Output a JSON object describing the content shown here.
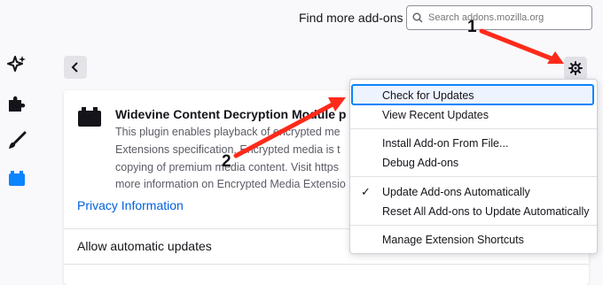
{
  "header": {
    "find_more_label": "Find more add-ons",
    "search_placeholder": "Search addons.mozilla.org"
  },
  "sidebar": {
    "items": [
      {
        "name": "recommendations",
        "icon": "sparkle-icon"
      },
      {
        "name": "extensions",
        "icon": "puzzle-icon"
      },
      {
        "name": "themes",
        "icon": "brush-icon"
      },
      {
        "name": "plugins",
        "icon": "plugin-icon",
        "selected": true
      }
    ]
  },
  "addon": {
    "title": "Widevine Content Decryption Module p",
    "description_lines": [
      "This plugin enables playback of encrypted me",
      "Extensions specification. Encrypted media is t",
      "copying of premium media content. Visit https",
      "more information on Encrypted Media Extensio"
    ],
    "privacy_link": "Privacy Information",
    "auto_updates_label": "Allow automatic updates"
  },
  "menu": {
    "items": [
      {
        "label": "Check for Updates",
        "highlighted": true
      },
      {
        "label": "View Recent Updates"
      },
      {
        "label": "Install Add-on From File..."
      },
      {
        "label": "Debug Add-ons"
      },
      {
        "label": "Update Add-ons Automatically",
        "checked": true
      },
      {
        "label": "Reset All Add-ons to Update Automatically"
      },
      {
        "label": "Manage Extension Shortcuts"
      }
    ]
  },
  "annotations": {
    "step1": "1",
    "step2": "2",
    "arrow_color": "#ff2a1a"
  },
  "colors": {
    "accent": "#0a84ff",
    "link": "#0061e0",
    "selected_sidebar": "#0a84ff"
  }
}
